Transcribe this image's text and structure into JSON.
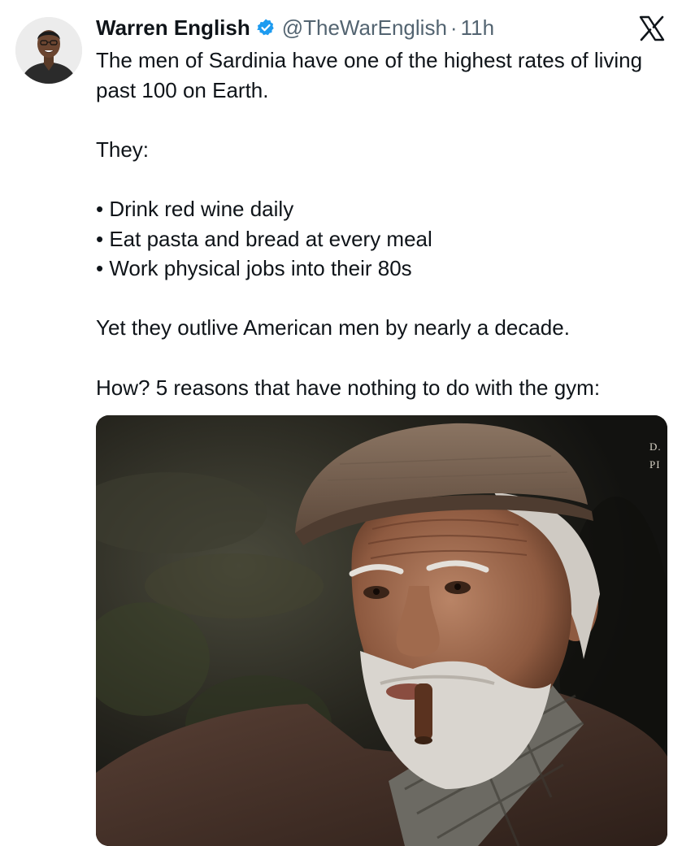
{
  "author": {
    "display_name": "Warren English",
    "handle": "@TheWarEnglish",
    "separator": "·",
    "time": "11h",
    "verified": true,
    "avatar_icon": "profile-photo"
  },
  "platform_icon": "x-logo-icon",
  "post": {
    "intro": "The men of Sardinia have one of the highest rates of living past 100 on Earth.",
    "they": "They:",
    "bullets": [
      "• Drink red wine daily",
      "• Eat pasta and bread at every meal",
      "• Work physical jobs into their 80s"
    ],
    "contrast": "Yet they outlive American men by nearly a decade.",
    "hook": "How? 5 reasons that have nothing to do with the gym:"
  },
  "media": {
    "alt_icon": "photo-elderly-man-with-cigar",
    "watermark_line1": "D.",
    "watermark_line2": "PI"
  },
  "colors": {
    "text_primary": "#0f1419",
    "text_secondary": "#536471",
    "verified_blue": "#1d9bf0"
  }
}
